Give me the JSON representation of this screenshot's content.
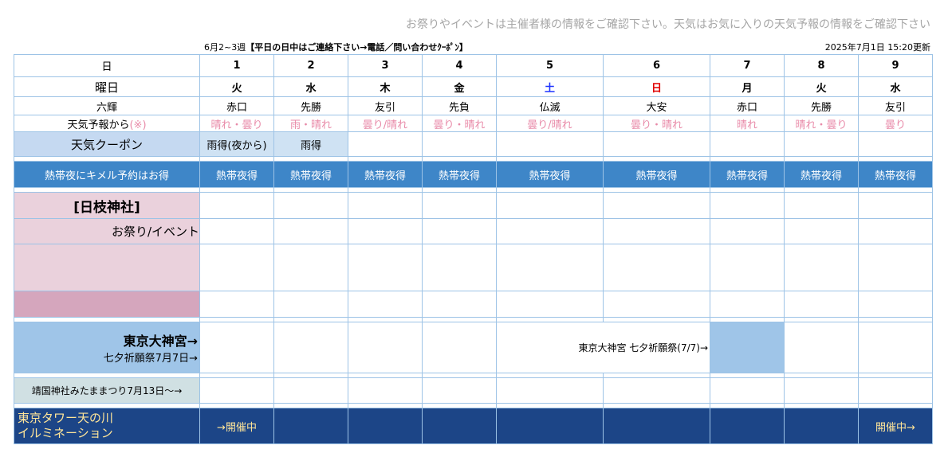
{
  "notice": "お祭りやイベントは主催者様の情報をご確認下さい。天気はお気に入りの天気予報の情報をご確認下さい",
  "period_prefix": "6月2~3週",
  "period_bold": "【平日の日中はご連絡下さい→電話／問い合わせｸｰﾎﾟﾝ】",
  "updated": "2025年7月1日 15:20更新",
  "labels": {
    "day": "日",
    "weekday": "曜日",
    "rokuyo": "六輝",
    "weather": "天気予報から",
    "weather_note": "(※)",
    "coupon": "天気クーポン",
    "hot_night": "熱帯夜にキメル予約はお得",
    "shrine1": "[日枝神社]",
    "shrine1_sub": "お祭り/イベント",
    "shrine2": "東京大神宮→",
    "shrine2_sub": "七夕祈願祭7月7日→",
    "shrine3": "靖国神社みたままつり7月13日～→",
    "tower_line1": "東京タワー天の川",
    "tower_line2": "イルミネーション"
  },
  "days": [
    {
      "date": "1",
      "weekday": "火",
      "rokuyo": "赤口",
      "weather": "晴れ・曇り",
      "coupon": "雨得(夜から)",
      "hot": "熱帯夜得"
    },
    {
      "date": "2",
      "weekday": "水",
      "rokuyo": "先勝",
      "weather": "雨・晴れ",
      "coupon": "雨得",
      "hot": "熱帯夜得"
    },
    {
      "date": "3",
      "weekday": "木",
      "rokuyo": "友引",
      "weather": "曇り/晴れ",
      "coupon": "",
      "hot": "熱帯夜得"
    },
    {
      "date": "4",
      "weekday": "金",
      "rokuyo": "先負",
      "weather": "曇り・晴れ",
      "coupon": "",
      "hot": "熱帯夜得"
    },
    {
      "date": "5",
      "weekday": "土",
      "rokuyo": "仏滅",
      "weather": "曇り/晴れ",
      "coupon": "",
      "hot": "熱帯夜得"
    },
    {
      "date": "6",
      "weekday": "日",
      "rokuyo": "大安",
      "weather": "曇り・晴れ",
      "coupon": "",
      "hot": "熱帯夜得"
    },
    {
      "date": "7",
      "weekday": "月",
      "rokuyo": "赤口",
      "weather": "晴れ",
      "coupon": "",
      "hot": "熱帯夜得"
    },
    {
      "date": "8",
      "weekday": "火",
      "rokuyo": "先勝",
      "weather": "晴れ・曇り",
      "coupon": "",
      "hot": "熱帯夜得"
    },
    {
      "date": "9",
      "weekday": "水",
      "rokuyo": "友引",
      "weather": "曇り",
      "coupon": "",
      "hot": "熱帯夜得"
    }
  ],
  "events": {
    "daijingu_festival": "東京大神宮 七夕祈願祭(7/7)→",
    "tower_start": "→開催中",
    "tower_end": "開催中→"
  }
}
